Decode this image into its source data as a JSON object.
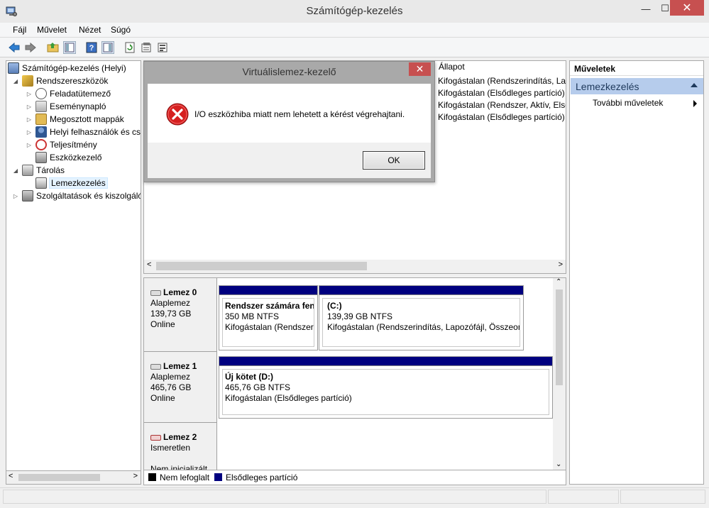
{
  "window": {
    "title": "Számítógép-kezelés",
    "min_glyph": "—",
    "max_glyph": "☐",
    "close_glyph": "✕"
  },
  "menu": {
    "items": [
      "Fájl",
      "Művelet",
      "Nézet",
      "Súgó"
    ]
  },
  "toolbar": {
    "icons": [
      "back-icon",
      "forward-icon",
      "up-folder-icon",
      "show-hide-tree-icon",
      "help-icon",
      "show-hide-action-pane-icon",
      "refresh-icon",
      "properties-icon",
      "export-icon"
    ]
  },
  "tree": {
    "items": [
      {
        "label": "Számítógép-kezelés (Helyi)",
        "level": 0,
        "arrow": "",
        "icon": "computer-management-icon"
      },
      {
        "label": "Rendszereszközök",
        "level": 1,
        "arrow": "◢",
        "icon": "system-tools-icon"
      },
      {
        "label": "Feladatütemező",
        "level": 2,
        "arrow": "▷",
        "icon": "task-scheduler-icon"
      },
      {
        "label": "Eseménynapló",
        "level": 2,
        "arrow": "▷",
        "icon": "event-viewer-icon"
      },
      {
        "label": "Megosztott mappák",
        "level": 2,
        "arrow": "▷",
        "icon": "shared-folders-icon"
      },
      {
        "label": "Helyi felhasználók és cs",
        "level": 2,
        "arrow": "▷",
        "icon": "local-users-icon"
      },
      {
        "label": "Teljesítmény",
        "level": 2,
        "arrow": "▷",
        "icon": "performance-icon"
      },
      {
        "label": "Eszközkezelő",
        "level": 2,
        "arrow": "",
        "icon": "device-manager-icon"
      },
      {
        "label": "Tárolás",
        "level": 1,
        "arrow": "◢",
        "icon": "storage-icon"
      },
      {
        "label": "Lemezkezelés",
        "level": 2,
        "arrow": "",
        "icon": "disk-management-icon",
        "selected": true
      },
      {
        "label": "Szolgáltatások és kiszolgáló",
        "level": 0.5,
        "arrow": "▷",
        "icon": "services-icon"
      }
    ]
  },
  "volumes": {
    "column_status": "Állapot",
    "status_rows": [
      "Kifogástalan (Rendszerindítás, Lap",
      "Kifogástalan (Elsődleges partíció)",
      "Kifogástalan (Rendszer, Aktív, Első",
      "Kifogástalan (Elsődleges partíció)"
    ]
  },
  "disks": [
    {
      "name": "Lemez 0",
      "type": "Alaplemez",
      "size": "139,73 GB",
      "state": "Online",
      "partitions": [
        {
          "name": "Rendszer számára fenn",
          "size": "350 MB NTFS",
          "status": "Kifogástalan (Rendszer, Aktív, Elsődleges partíció)"
        },
        {
          "name": "(C:)",
          "size": "139,39 GB NTFS",
          "status": "Kifogástalan (Rendszerindítás, Lapozófájl, Összeomlási memóriakép, Elsődleges partíció)"
        }
      ]
    },
    {
      "name": "Lemez 1",
      "type": "Alaplemez",
      "size": "465,76 GB",
      "state": "Online",
      "partitions": [
        {
          "name": "Új kötet  (D:)",
          "size": "465,76 GB NTFS",
          "status": "Kifogástalan (Elsődleges partíció)"
        }
      ]
    },
    {
      "name": "Lemez 2",
      "type": "Ismeretlen",
      "size": "",
      "state": "Nem inicializált",
      "partitions": []
    }
  ],
  "legend": {
    "items": [
      {
        "label": "Nem lefoglalt",
        "color": "#000000"
      },
      {
        "label": "Elsődleges partíció",
        "color": "#00007f"
      }
    ]
  },
  "actions": {
    "header": "Műveletek",
    "section": "Lemezkezelés",
    "more": "További műveletek"
  },
  "dialog": {
    "title": "Virtuálislemez-kezelő",
    "message": "I/O eszközhiba miatt nem lehetett a kérést végrehajtani.",
    "ok": "OK",
    "close_glyph": "✕",
    "icon": "error-icon"
  },
  "colors": {
    "partition_bar": "#00007f",
    "actions_section": "#b6ccec",
    "close_button": "#c75050"
  }
}
